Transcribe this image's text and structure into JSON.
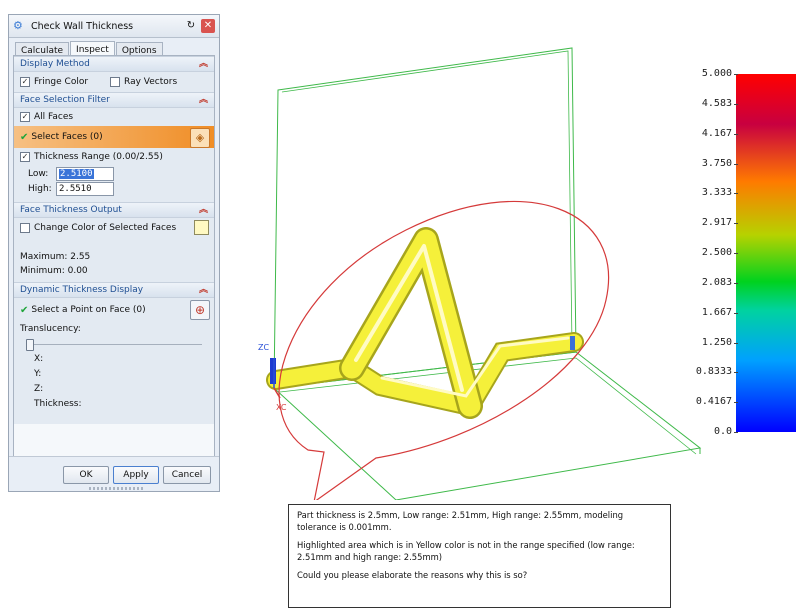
{
  "dialog": {
    "title": "Check Wall Thickness",
    "tabs": [
      "Calculate",
      "Inspect",
      "Options"
    ],
    "active_tab": "Inspect",
    "display_method": {
      "header": "Display Method",
      "fringe_color": {
        "label": "Fringe Color",
        "checked": true
      },
      "ray_vectors": {
        "label": "Ray Vectors",
        "checked": false
      }
    },
    "face_selection_filter": {
      "header": "Face Selection Filter",
      "all_faces": {
        "label": "All Faces",
        "checked": true
      },
      "select_faces": {
        "label": "Select Faces (0)"
      },
      "thickness_range": {
        "label": "Thickness Range (0.00/2.55)",
        "checked": true
      },
      "low": {
        "label": "Low:",
        "value": "2.5100"
      },
      "high": {
        "label": "High:",
        "value": "2.5510"
      }
    },
    "face_thickness_output": {
      "header": "Face Thickness Output",
      "change_color": {
        "label": "Change Color of Selected Faces",
        "checked": false
      },
      "maximum": "Maximum: 2.55",
      "minimum": "Minimum: 0.00"
    },
    "dynamic_thickness_display": {
      "header": "Dynamic Thickness Display",
      "select_point": "Select a Point on Face (0)",
      "translucency": "Translucency:",
      "translucency_value": 0,
      "x": "X:",
      "y": "Y:",
      "z": "Z:",
      "thickness": "Thickness:"
    },
    "buttons": {
      "ok": "OK",
      "apply": "Apply",
      "cancel": "Cancel"
    }
  },
  "viewport": {
    "axis_zc": "ZC",
    "axis_xc": "XC"
  },
  "legend": {
    "labels": [
      "5.000",
      "4.583",
      "4.167",
      "3.750",
      "3.333",
      "2.917",
      "2.500",
      "2.083",
      "1.667",
      "1.250",
      "0.8333",
      "0.4167",
      "0.0"
    ]
  },
  "note": {
    "paragraphs": [
      "Part thickness is 2.5mm, Low range: 2.51mm, High range: 2.55mm, modeling tolerance is 0.001mm.",
      "Highlighted area which is in Yellow color is not in the range specified (low range: 2.51mm and high range: 2.55mm)",
      "Could you please elaborate the reasons why this is so?"
    ]
  },
  "colors": {
    "highlight_yellow": "#f5f03a",
    "wireframe_green": "#3fb94a",
    "annotation_red": "#d53a3a",
    "select_orange": "#f08d25"
  }
}
